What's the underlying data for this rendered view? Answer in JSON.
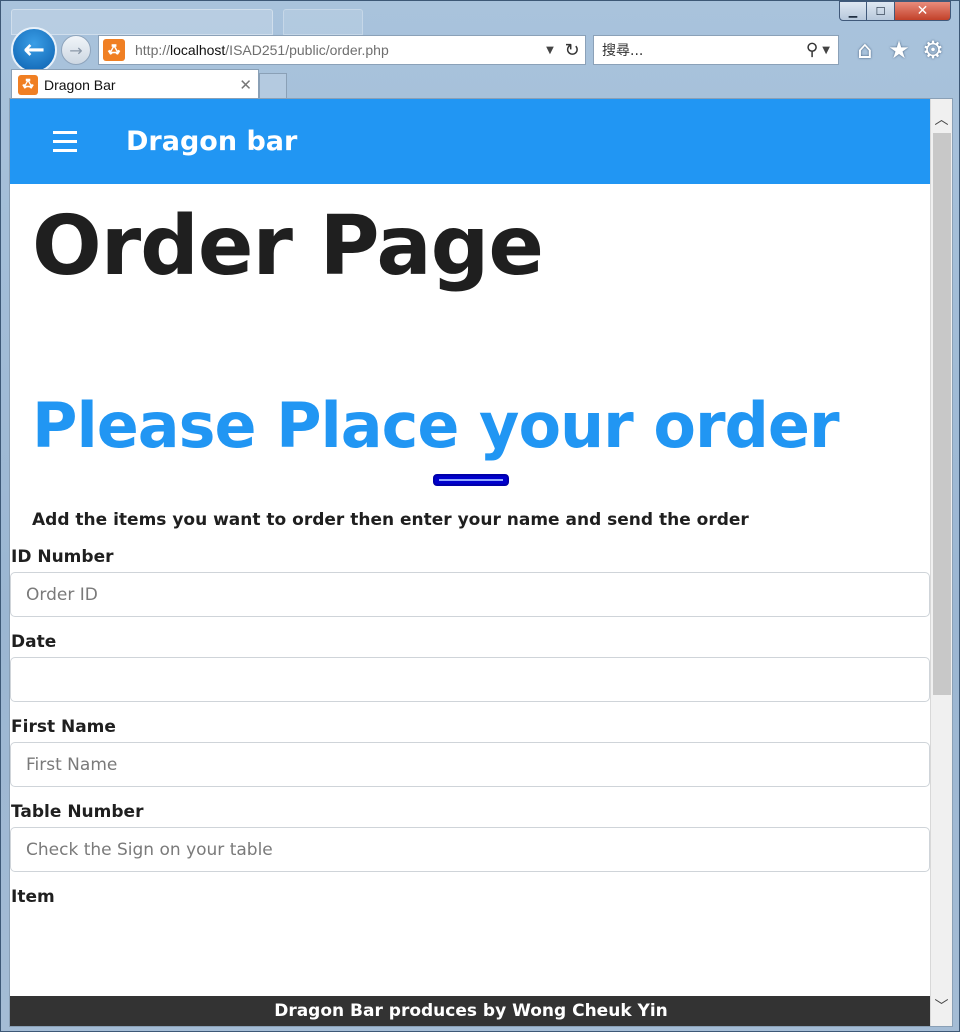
{
  "browser": {
    "address_prefix": "http://",
    "address_host": "localhost",
    "address_path": "/ISAD251/public/order.php",
    "search_placeholder": "搜尋...",
    "tab_title": "Dragon Bar",
    "site_icon_glyph": "ꗈ"
  },
  "navbar": {
    "brand": "Dragon bar"
  },
  "page": {
    "title": "Order Page",
    "subtitle": "Please Place your order",
    "instructions": "Add the items you want to order then enter your name and send the order"
  },
  "form": {
    "fields": [
      {
        "label": "ID Number",
        "placeholder": "Order ID",
        "value": ""
      },
      {
        "label": "Date",
        "placeholder": "",
        "value": ""
      },
      {
        "label": "First Name",
        "placeholder": "First Name",
        "value": ""
      },
      {
        "label": "Table Number",
        "placeholder": "Check the Sign on your table",
        "value": ""
      },
      {
        "label": "Item",
        "placeholder": "",
        "value": ""
      }
    ]
  },
  "footer": {
    "text": "Dragon Bar produces by Wong Cheuk Yin"
  },
  "colors": {
    "navbar": "#2196f3",
    "subtitle": "#2196f3",
    "divider": "#0000cc",
    "footer": "#333333"
  }
}
